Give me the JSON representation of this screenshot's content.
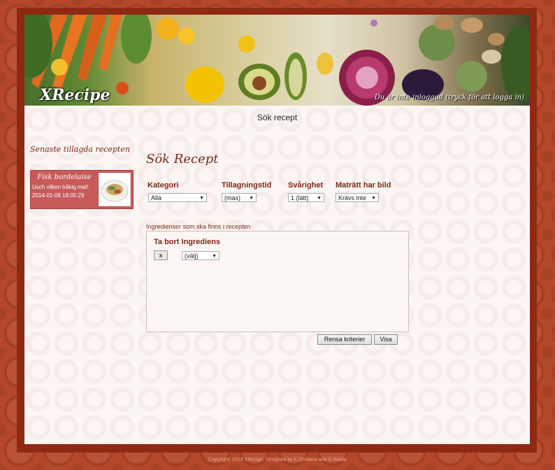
{
  "header": {
    "site_title": "XRecipe",
    "login_status": "Du är inte inloggad (tryck för att logga in)"
  },
  "page": {
    "heading": "Sök recept"
  },
  "sidebar": {
    "title": "Senaste tillagda recepten",
    "recent_recipes": [
      {
        "name": "Fisk bordelaise",
        "description": "Usch vilken tråkig mat!",
        "date": "2014-01-06 18:05:29"
      }
    ]
  },
  "search": {
    "title": "Sök Recept",
    "filters": [
      {
        "label": "Kategori",
        "value": "Alla"
      },
      {
        "label": "Tillagningstid",
        "value": "(max)"
      },
      {
        "label": "Svårighet",
        "value": "1 (lätt)"
      },
      {
        "label": "Maträtt har bild",
        "value": "Krävs inte"
      }
    ],
    "ingredients_label": "Ingredienser som ska finns i recepten",
    "remove_title": "Ta bort Ingrediens",
    "remove_button": "x",
    "ingredient_select": "(välj)",
    "clear_button": "Rensa kriterier",
    "show_button": "Visa"
  },
  "footer": {
    "text": "Copyright, 2013 XRecipe. Designed by K.Orellana and G.Wiiala"
  },
  "icons": {
    "dropdown": "chevron-down-icon"
  },
  "colors": {
    "background": "#b5472a",
    "frame": "#8e2a12",
    "content": "#fbf6f4",
    "heading": "#7a2a1a",
    "card": "#c85a5a"
  }
}
